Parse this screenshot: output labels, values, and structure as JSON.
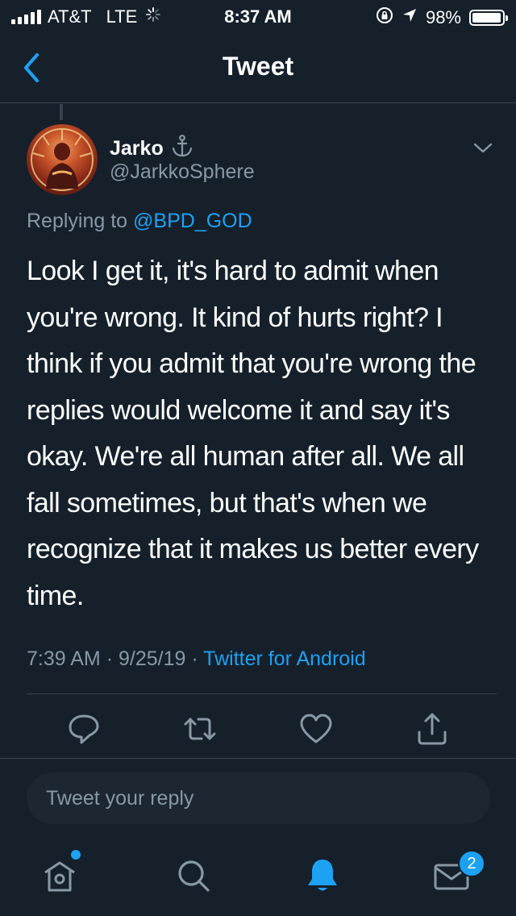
{
  "status_bar": {
    "carrier": "AT&T",
    "network": "LTE",
    "time": "8:37 AM",
    "battery": "98%",
    "battery_level": 0.98
  },
  "nav": {
    "title": "Tweet",
    "back_icon": "chevron-left-icon"
  },
  "tweet": {
    "display_name": "Jarko",
    "name_emoji": "⚓",
    "username": "@JarkkoSphere",
    "replying_prefix": "Replying to",
    "replying_to": "@BPD_GOD",
    "text": "Look I get it, it's hard to admit when you're wrong. It kind of hurts right? I think if you admit that you're wrong the replies would welcome it and say it's okay. We're all human after all. We all fall sometimes, but that's when we recognize that it makes us better every time.",
    "time": "7:39 AM",
    "date": "9/25/19",
    "separator": "·",
    "source": "Twitter for Android"
  },
  "actions": [
    "reply-icon",
    "retweet-icon",
    "like-icon",
    "share-icon"
  ],
  "reply_box": {
    "placeholder": "Tweet your reply"
  },
  "tab_bar": {
    "items": [
      "home-icon",
      "search-icon",
      "notifications-icon",
      "messages-icon"
    ],
    "messages_badge": "2"
  },
  "colors": {
    "background": "#15202b",
    "accent": "#1da1f2",
    "secondary_text": "#8899a6",
    "divider": "#38444d"
  }
}
